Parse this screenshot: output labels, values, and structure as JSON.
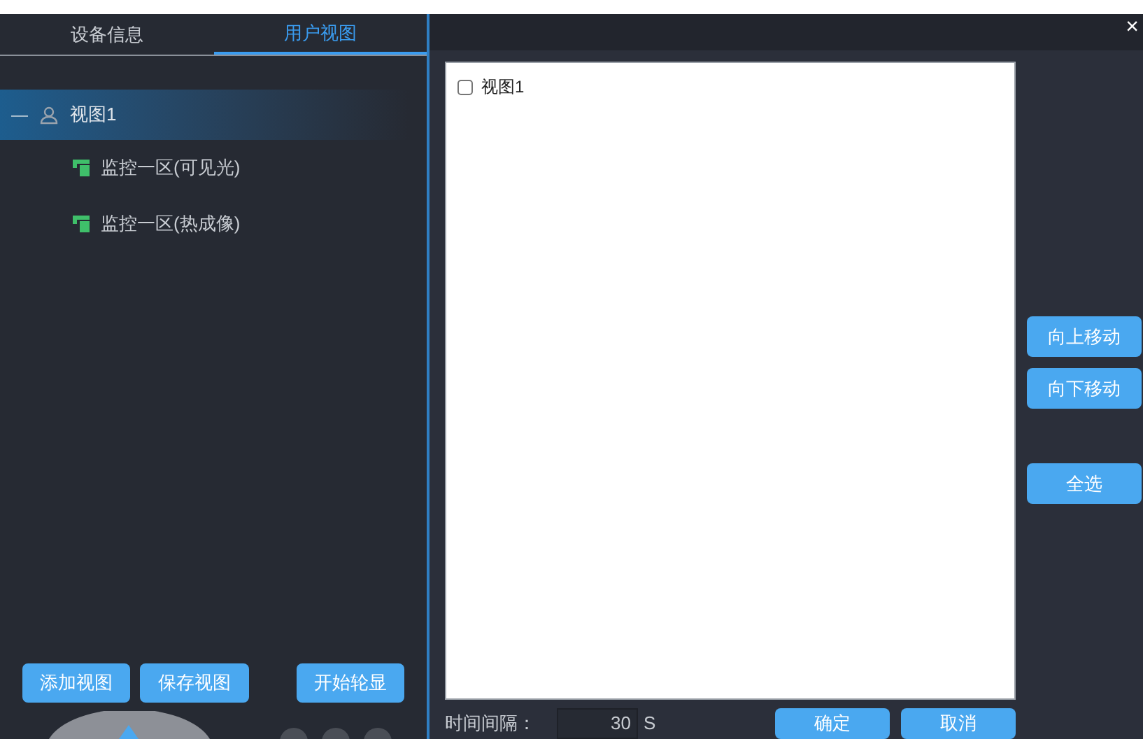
{
  "close_label": "×",
  "tabs": [
    {
      "label": "设备信息",
      "selected": false
    },
    {
      "label": "用户视图",
      "selected": true
    }
  ],
  "tree": [
    {
      "label": "视图1",
      "expanded": true,
      "selected": true,
      "toggle": "—",
      "children": [
        {
          "label": "监控一区(可见光)",
          "selected": false
        },
        {
          "label": "监控一区(热成像)",
          "selected": false
        }
      ]
    }
  ],
  "left_buttons": [
    "添加视图",
    "保存视图",
    "开始轮显"
  ],
  "view_list": [
    {
      "label": "视图1",
      "checked": false
    }
  ],
  "side_buttons": [
    "向上移动",
    "向下移动",
    "全选"
  ],
  "interval": {
    "label": "时间间隔：",
    "value": "30",
    "unit": "S"
  },
  "dialog_buttons": [
    "确定",
    "取消"
  ]
}
